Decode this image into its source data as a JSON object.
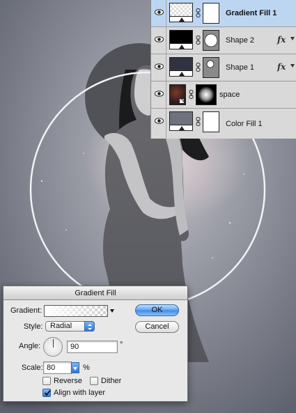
{
  "layers_panel": {
    "layers": [
      {
        "name": "Gradient Fill 1",
        "selected": true,
        "has_fx": false,
        "thumb": "gradient-fill",
        "mask": "white"
      },
      {
        "name": "Shape 2",
        "selected": false,
        "has_fx": true,
        "thumb": "black-fill",
        "mask": "circle-large"
      },
      {
        "name": "Shape 1",
        "selected": false,
        "has_fx": true,
        "thumb": "dark-fill",
        "mask": "circle-small"
      },
      {
        "name": "space",
        "selected": false,
        "has_fx": false,
        "thumb": "photo",
        "mask": "radial"
      },
      {
        "name": "Color Fill 1",
        "selected": false,
        "has_fx": false,
        "thumb": "color-fill",
        "mask": "white"
      }
    ],
    "fx_symbol": "fx",
    "colors": {
      "selected_row": "#bcd6f2",
      "panel_bg": "#d9d9d9"
    }
  },
  "dialog": {
    "title": "Gradient Fill",
    "gradient_label": "Gradient:",
    "style_label": "Style:",
    "style_value": "Radial",
    "angle_label": "Angle:",
    "angle_value": "90",
    "degree_symbol": "°",
    "scale_label": "Scale:",
    "scale_value": "80",
    "scale_unit": "%",
    "reverse_label": "Reverse",
    "reverse_checked": false,
    "dither_label": "Dither",
    "dither_checked": false,
    "align_label": "Align with layer",
    "align_checked": true,
    "ok_label": "OK",
    "cancel_label": "Cancel"
  }
}
